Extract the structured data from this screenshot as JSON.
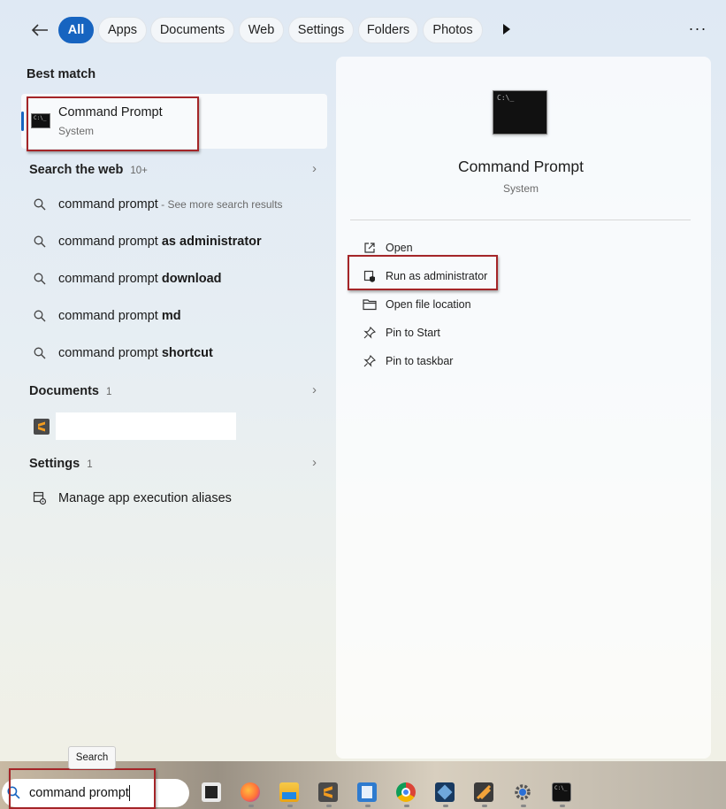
{
  "filters": {
    "tabs": [
      "All",
      "Apps",
      "Documents",
      "Web",
      "Settings",
      "Folders",
      "Photos"
    ],
    "active": "All",
    "more_label": "···"
  },
  "best_match": {
    "heading": "Best match",
    "title": "Command Prompt",
    "subtitle": "System"
  },
  "web": {
    "heading": "Search the web",
    "count": "10+",
    "items": [
      {
        "prefix": "command prompt",
        "bold": "",
        "suffix": " - See more search results"
      },
      {
        "prefix": "command prompt ",
        "bold": "as administrator",
        "suffix": ""
      },
      {
        "prefix": "command prompt ",
        "bold": "download",
        "suffix": ""
      },
      {
        "prefix": "command prompt ",
        "bold": "md",
        "suffix": ""
      },
      {
        "prefix": "command prompt ",
        "bold": "shortcut",
        "suffix": ""
      }
    ]
  },
  "documents": {
    "heading": "Documents",
    "count": "1"
  },
  "settings": {
    "heading": "Settings",
    "count": "1",
    "item": "Manage app execution aliases"
  },
  "preview": {
    "title": "Command Prompt",
    "subtitle": "System",
    "actions": [
      "Open",
      "Run as administrator",
      "Open file location",
      "Pin to Start",
      "Pin to taskbar"
    ]
  },
  "taskbar": {
    "search_value": "command prompt",
    "tooltip": "Search"
  },
  "colors": {
    "accent": "#1764c0",
    "highlight_box": "#a42528"
  }
}
